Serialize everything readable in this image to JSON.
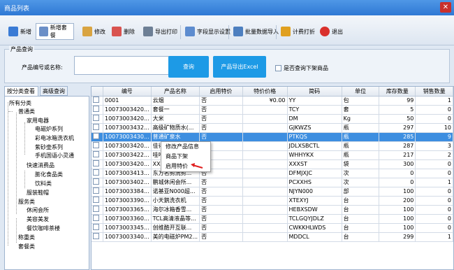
{
  "window": {
    "title": "商品列表",
    "close": "✕"
  },
  "toolbar": {
    "buttons": [
      {
        "label": "新增",
        "icon": "add-icon",
        "color": "#3a7bd5"
      },
      {
        "label": "新增套餐",
        "icon": "package-icon",
        "color": "#6b8fc7"
      },
      {
        "label": "修改",
        "icon": "edit-icon",
        "color": "#d9a441"
      },
      {
        "label": "删除",
        "icon": "delete-icon",
        "color": "#d9534f"
      },
      {
        "label": "导出打印",
        "icon": "print-icon",
        "color": "#6d7f95"
      },
      {
        "label": "字段显示设置",
        "icon": "columns-icon",
        "color": "#5d8ccf"
      },
      {
        "label": "批量数据导入",
        "icon": "import-icon",
        "color": "#4d7fbf"
      },
      {
        "label": "计费打折",
        "icon": "discount-icon",
        "color": "#e0a020"
      },
      {
        "label": "退出",
        "icon": "exit-icon",
        "color": "#d9302c"
      }
    ]
  },
  "query": {
    "legend": "产品查询",
    "field_label": "产品编号或名称:",
    "field_value": "",
    "search_button": "查询",
    "export_button": "产品导出Excel",
    "checkbox_label": "是否查询下架商品"
  },
  "tabs": [
    "按分类查看",
    "高级查询"
  ],
  "tree": [
    "所有分类",
    "普通类",
    "家用电器",
    "电磁炉系列",
    "彩电冰箱洗衣机",
    "紫砂壶系列",
    "手机国语小灵通",
    "快速消费品",
    "膨化食品类",
    "饮料类",
    "服装鞋帽",
    "服务类",
    "休闲会所",
    "美容美发",
    "餐饮咖啡茶楼",
    "称重类",
    "套餐类"
  ],
  "table": {
    "columns": [
      "",
      "编号",
      "产品名称",
      "启用特价",
      "特价价格",
      "简码",
      "单位",
      "库存数量",
      "销售数量"
    ],
    "rows": [
      [
        "0001",
        "云烟",
        "否",
        "¥0.00",
        "YY",
        "包",
        "99",
        "1"
      ],
      [
        "10073003420...",
        "套餐一",
        "否",
        "",
        "TCY",
        "套",
        "5",
        "0"
      ],
      [
        "10073003420...",
        "大米",
        "否",
        "",
        "DM",
        "Kg",
        "50",
        "0"
      ],
      [
        "10073003432...",
        "高级矿物质水(...",
        "否",
        "",
        "GJKWZS",
        "瓶",
        "297",
        "10"
      ],
      [
        "10073003430...",
        "普通矿泉水",
        "否",
        "",
        "PTKQS",
        "瓶",
        "285",
        "9"
      ],
      [
        "10073003420...",
        "佳得乐...",
        "否",
        "",
        "JDLXSBCTL",
        "瓶",
        "287",
        "3"
      ],
      [
        "10073003422...",
        "哇哈哈...",
        "否",
        "",
        "WHHYKX",
        "瓶",
        "217",
        "2"
      ],
      [
        "10073003420...",
        "XXX香...",
        "否",
        "",
        "XXXST",
        "袋",
        "300",
        "0"
      ],
      [
        "10073003413...",
        "东方名剪洗剪...",
        "否",
        "",
        "DFMJXJC",
        "次",
        "0",
        "0"
      ],
      [
        "10073003402...",
        "鹏城休闲会所...",
        "否",
        "",
        "PCXXHS",
        "次",
        "0",
        "1"
      ],
      [
        "10073003384...",
        "诺基亚N000超...",
        "否",
        "",
        "NJYN000",
        "部",
        "100",
        "0"
      ],
      [
        "10073003390...",
        "小天鹅洗衣机",
        "否",
        "",
        "XTEXYJ",
        "台",
        "200",
        "0"
      ],
      [
        "10073003365...",
        "海尔冰箱香雪...",
        "否",
        "",
        "HEBXSDW",
        "台",
        "100",
        "0"
      ],
      [
        "10073003360...",
        "TCL高清液晶等...",
        "否",
        "",
        "TCLGQYJDLZ",
        "台",
        "100",
        "0"
      ],
      [
        "10073003345...",
        "创维酷开互联...",
        "否",
        "",
        "CWKKHLWDS",
        "台",
        "100",
        "0"
      ],
      [
        "10073003340...",
        "美的电磁炉PM2...",
        "否",
        "",
        "MDDCL",
        "台",
        "299",
        "1"
      ]
    ],
    "selected_row": 4
  },
  "context_menu": [
    "修改产品信息",
    "商品下架",
    "启用特价"
  ]
}
